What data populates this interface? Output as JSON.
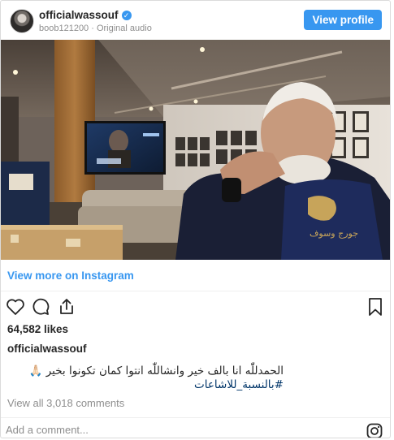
{
  "header": {
    "username": "officialwassouf",
    "verified": true,
    "subtitle": "boob121200 · Original audio",
    "view_profile_label": "View profile"
  },
  "media": {
    "tv_overlay_label": "",
    "towel_print": "جورج وسوف"
  },
  "view_more": {
    "label": "View more on Instagram"
  },
  "actions": {
    "icons": [
      "heart-icon",
      "comment-icon",
      "share-icon",
      "bookmark-icon"
    ]
  },
  "likes": {
    "text": "64,582 likes"
  },
  "caption": {
    "username": "officialwassouf",
    "line1": "الحمدللّٰه انا بالف خير وانشاللّٰه انتوا كمان تكونوا بخير 🙏🏻",
    "line2": "#بالنسبة_للاشاعات"
  },
  "comments": {
    "view_all": "View all 3,018 comments"
  },
  "comment_box": {
    "placeholder": "Add a comment..."
  },
  "colors": {
    "accent": "#3897f0",
    "text": "#262626",
    "muted": "#8e8e8e",
    "hashtag": "#003569"
  }
}
